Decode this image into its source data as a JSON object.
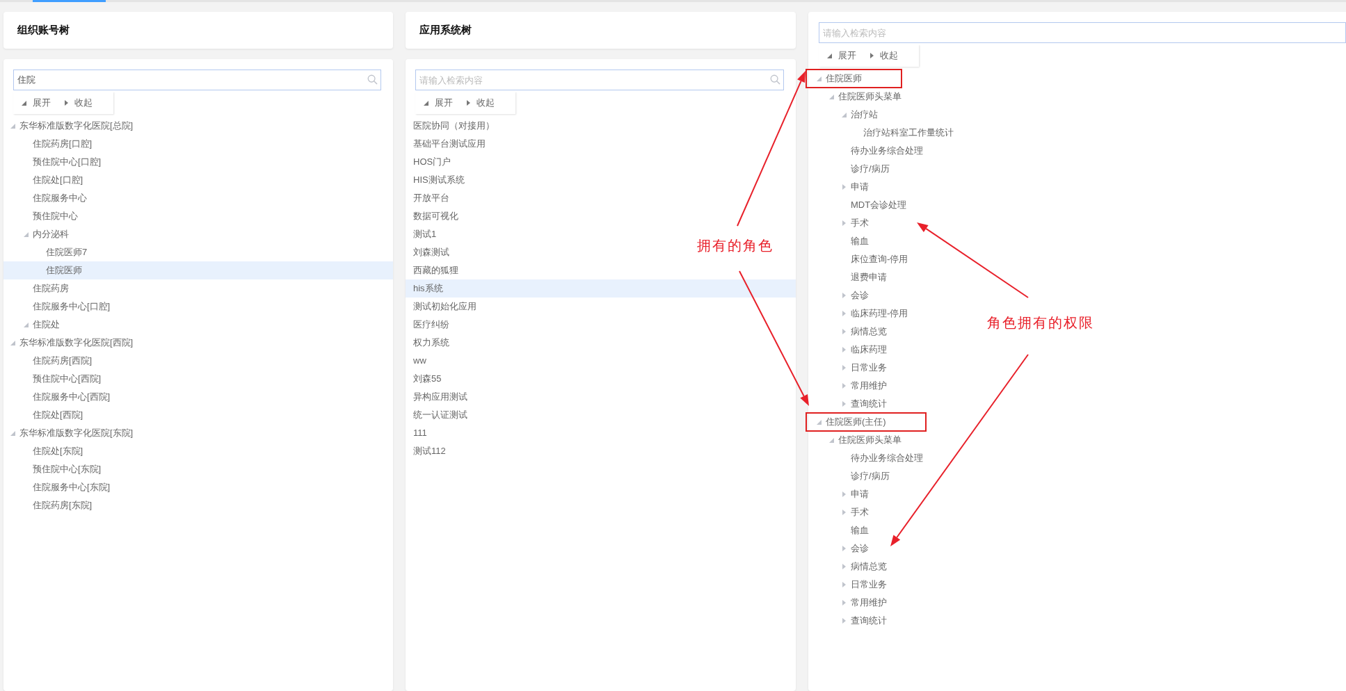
{
  "top_tabs": [
    {
      "selected": true
    }
  ],
  "org_panel": {
    "title": "组织账号树",
    "search": {
      "value": "住院"
    },
    "toolbar": {
      "expand": "展开",
      "collapse": "收起"
    },
    "tree": [
      {
        "label": "东华标准版数字化医院[总院]",
        "expanded": true,
        "selected": false,
        "children": [
          {
            "label": "住院药房[口腔]",
            "selected": false
          },
          {
            "label": "预住院中心[口腔]",
            "selected": false
          },
          {
            "label": "住院处[口腔]",
            "selected": false
          },
          {
            "label": "住院服务中心",
            "selected": false
          },
          {
            "label": "预住院中心",
            "selected": false
          },
          {
            "label": "内分泌科",
            "expanded": true,
            "selected": false,
            "children": [
              {
                "label": "住院医师7",
                "selected": false
              },
              {
                "label": "住院医师",
                "selected": true
              }
            ]
          },
          {
            "label": "住院药房",
            "selected": false
          },
          {
            "label": "住院服务中心[口腔]",
            "selected": false
          },
          {
            "label": "住院处",
            "expanded": true,
            "selected": false
          }
        ]
      },
      {
        "label": "东华标准版数字化医院[西院]",
        "expanded": true,
        "selected": false,
        "children": [
          {
            "label": "住院药房[西院]",
            "selected": false
          },
          {
            "label": "预住院中心[西院]",
            "selected": false
          },
          {
            "label": "住院服务中心[西院]",
            "selected": false
          },
          {
            "label": "住院处[西院]",
            "selected": false
          }
        ]
      },
      {
        "label": "东华标准版数字化医院[东院]",
        "expanded": true,
        "selected": false,
        "children": [
          {
            "label": "住院处[东院]",
            "selected": false
          },
          {
            "label": "预住院中心[东院]",
            "selected": false
          },
          {
            "label": "住院服务中心[东院]",
            "selected": false
          },
          {
            "label": "住院药房[东院]",
            "selected": false
          }
        ]
      }
    ]
  },
  "app_panel": {
    "title": "应用系统树",
    "search": {
      "placeholder": "请输入检索内容"
    },
    "toolbar": {
      "expand": "展开",
      "collapse": "收起"
    },
    "items": [
      {
        "label": "医院协同（对接用）",
        "selected": false
      },
      {
        "label": "基础平台测试应用",
        "selected": false
      },
      {
        "label": "HOS门户",
        "selected": false
      },
      {
        "label": "HIS测试系统",
        "selected": false
      },
      {
        "label": "开放平台",
        "selected": false
      },
      {
        "label": "数据可视化",
        "selected": false
      },
      {
        "label": "测试1",
        "selected": false
      },
      {
        "label": "刘森测试",
        "selected": false
      },
      {
        "label": "西藏的狐狸",
        "selected": false
      },
      {
        "label": "his系统",
        "selected": true
      },
      {
        "label": "测试初始化应用",
        "selected": false
      },
      {
        "label": "医疗纠纷",
        "selected": false
      },
      {
        "label": "权力系统",
        "selected": false
      },
      {
        "label": "ww",
        "selected": false
      },
      {
        "label": "刘森55",
        "selected": false
      },
      {
        "label": "异构应用测试",
        "selected": false
      },
      {
        "label": "统一认证测试",
        "selected": false
      },
      {
        "label": "111",
        "selected": false
      },
      {
        "label": "测试112",
        "selected": false
      }
    ]
  },
  "role_panel": {
    "search": {
      "placeholder": "请输入检索内容"
    },
    "toolbar": {
      "expand": "展开",
      "collapse": "收起"
    },
    "tree": [
      {
        "label": "住院医师",
        "expanded": true,
        "boxed": true,
        "children": [
          {
            "label": "住院医师头菜单",
            "expanded": true,
            "children": [
              {
                "label": "治疗站",
                "expanded": true,
                "children": [
                  {
                    "label": "治疗站科室工作量统计"
                  }
                ]
              },
              {
                "label": "待办业务综合处理"
              },
              {
                "label": "诊疗/病历"
              },
              {
                "label": "申请",
                "expanded": false
              },
              {
                "label": "MDT会诊处理"
              },
              {
                "label": "手术",
                "expanded": false
              },
              {
                "label": "输血"
              },
              {
                "label": "床位查询-停用"
              },
              {
                "label": "退费申请"
              },
              {
                "label": "会诊",
                "expanded": false
              },
              {
                "label": "临床药理-停用",
                "expanded": false
              },
              {
                "label": "病情总览",
                "expanded": false
              },
              {
                "label": "临床药理",
                "expanded": false
              },
              {
                "label": "日常业务",
                "expanded": false
              },
              {
                "label": "常用维护",
                "expanded": false
              },
              {
                "label": "查询统计",
                "expanded": false
              }
            ]
          }
        ]
      },
      {
        "label": "住院医师(主任)",
        "expanded": true,
        "boxed": true,
        "children": [
          {
            "label": "住院医师头菜单",
            "expanded": true,
            "children": [
              {
                "label": "待办业务综合处理"
              },
              {
                "label": "诊疗/病历"
              },
              {
                "label": "申请",
                "expanded": false
              },
              {
                "label": "手术",
                "expanded": false
              },
              {
                "label": "输血"
              },
              {
                "label": "会诊",
                "expanded": false
              },
              {
                "label": "病情总览",
                "expanded": false
              },
              {
                "label": "日常业务",
                "expanded": false
              },
              {
                "label": "常用维护",
                "expanded": false
              },
              {
                "label": "查询统计",
                "expanded": false
              }
            ]
          }
        ]
      }
    ]
  },
  "annotations": [
    {
      "text": "拥有的角色"
    },
    {
      "text": "角色拥有的权限"
    }
  ]
}
